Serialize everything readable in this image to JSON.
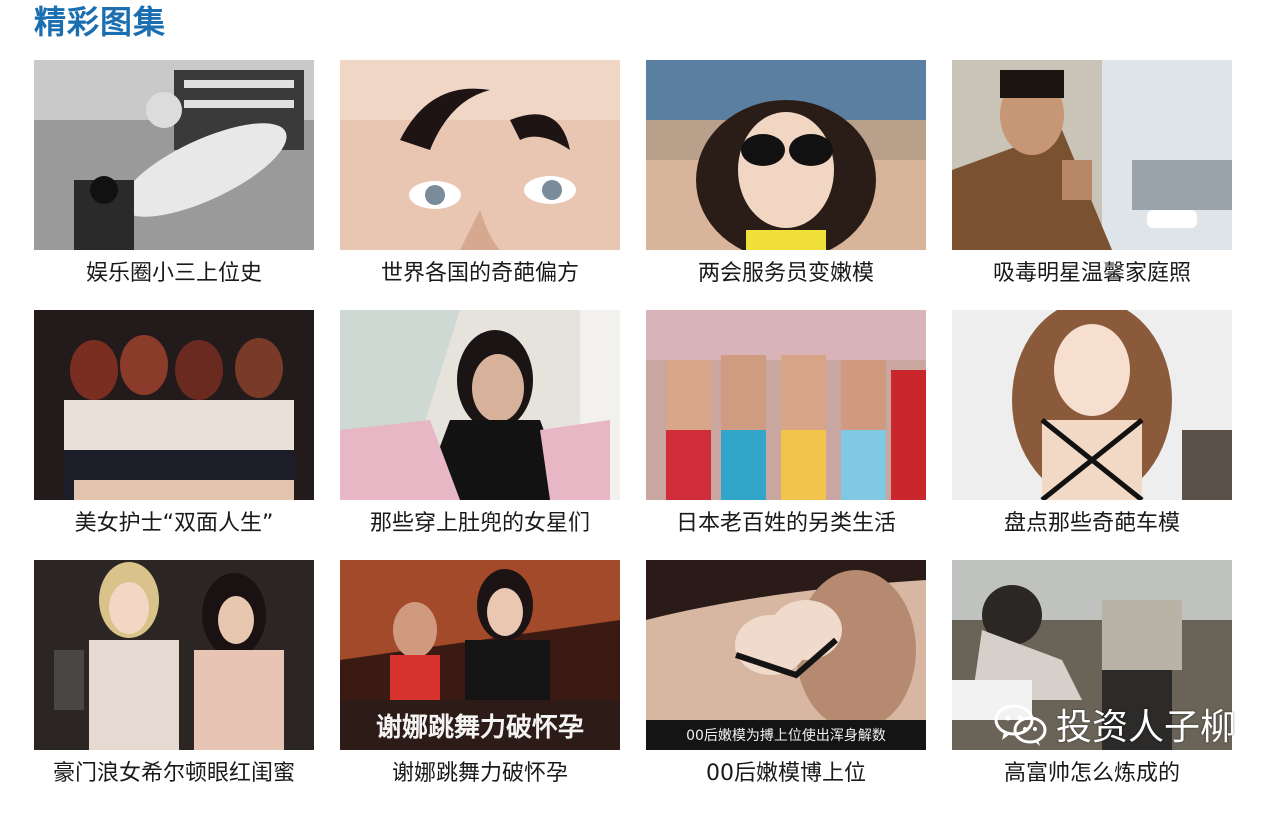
{
  "section": {
    "title": "精彩图集"
  },
  "gallery": {
    "items": [
      {
        "caption": "娱乐圈小三上位史"
      },
      {
        "caption": "世界各国的奇葩偏方"
      },
      {
        "caption": "两会服务员变嫩模"
      },
      {
        "caption": "吸毒明星温馨家庭照"
      },
      {
        "caption": "美女护士“双面人生”"
      },
      {
        "caption": "那些穿上肚兜的女星们"
      },
      {
        "caption": "日本老百姓的另类生活"
      },
      {
        "caption": "盘点那些奇葩车模"
      },
      {
        "caption": "豪门浪女希尔顿眼红闺蜜"
      },
      {
        "caption": "谢娜跳舞力破怀孕"
      },
      {
        "caption": "00后嫩模博上位"
      },
      {
        "caption": "高富帅怎么炼成的"
      }
    ]
  },
  "overlays": {
    "photo_10_text": "谢娜跳舞力破怀孕",
    "photo_11_text": "00后嫩模为搏上位使出浑身解数"
  },
  "watermark": {
    "text": "投资人子柳",
    "icon": "wechat-icon"
  },
  "colors": {
    "title": "#1b6fb0",
    "caption": "#1a1a1a",
    "background": "#ffffff"
  }
}
